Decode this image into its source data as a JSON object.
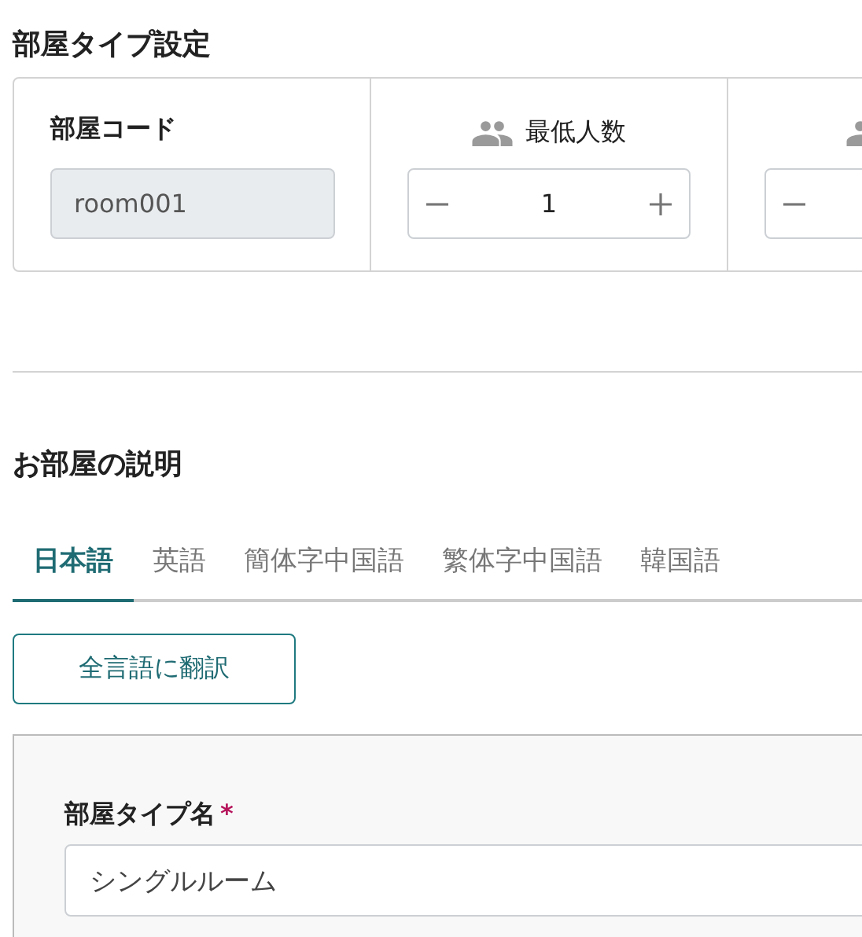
{
  "settings": {
    "title": "部屋タイプ設定",
    "cells": [
      {
        "kind": "code",
        "label": "部屋コード",
        "value": "room001"
      },
      {
        "kind": "counter",
        "label": "最低人数",
        "value": "1"
      },
      {
        "kind": "counter"
      }
    ]
  },
  "description": {
    "title": "お部屋の説明",
    "tabs": [
      {
        "label": "日本語",
        "selected": true
      },
      {
        "label": "英語",
        "selected": false
      },
      {
        "label": "簡体字中国語",
        "selected": false
      },
      {
        "label": "繁体字中国語",
        "selected": false
      },
      {
        "label": "韓国語",
        "selected": false
      }
    ],
    "translate_button": "全言語に翻訳",
    "form": {
      "label": "部屋タイプ名",
      "required_mark": "*",
      "value": "シングルルーム"
    }
  }
}
